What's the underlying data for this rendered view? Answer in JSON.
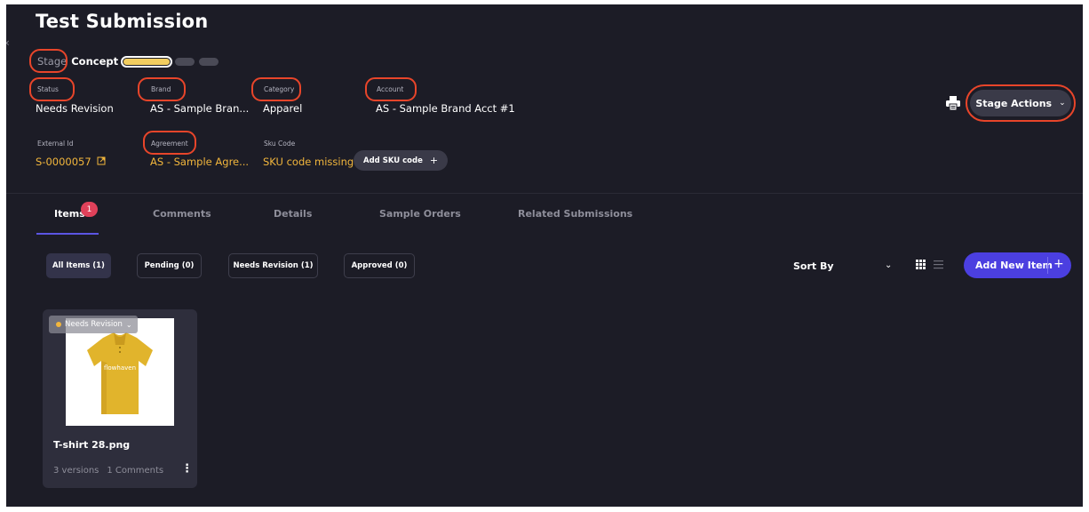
{
  "header": {
    "title": "Test Submission"
  },
  "stage": {
    "label": "Stage",
    "value": "Concept"
  },
  "fields": {
    "status": {
      "label": "Status",
      "value": "Needs Revision"
    },
    "brand": {
      "label": "Brand",
      "value": "AS - Sample Bran..."
    },
    "category": {
      "label": "Category",
      "value": "Apparel"
    },
    "account": {
      "label": "Account",
      "value": "AS - Sample Brand Acct #1"
    },
    "external_id": {
      "label": "External Id",
      "value": "S-0000057"
    },
    "agreement": {
      "label": "Agreement",
      "value": "AS - Sample Agre..."
    },
    "sku_code": {
      "label": "Sku Code",
      "value": "SKU code missing",
      "add_label": "Add SKU code"
    }
  },
  "actions": {
    "stage_actions_label": "Stage Actions"
  },
  "tabs": [
    {
      "label": "Items",
      "badge": "1"
    },
    {
      "label": "Comments"
    },
    {
      "label": "Details"
    },
    {
      "label": "Sample Orders"
    },
    {
      "label": "Related Submissions"
    }
  ],
  "filters": [
    {
      "label": "All Items (1)"
    },
    {
      "label": "Pending (0)"
    },
    {
      "label": "Needs Revision (1)"
    },
    {
      "label": "Approved (0)"
    }
  ],
  "toolbar": {
    "sort_label": "Sort By",
    "add_item_label": "Add New Item"
  },
  "items": [
    {
      "status": "Needs Revision",
      "image_text": "flowhaven",
      "filename": "T-shirt 28.png",
      "versions": "3 versions",
      "comments": "1 Comments"
    }
  ],
  "colors": {
    "background": "#1c1c26",
    "accent": "#4b3fe0",
    "link": "#f2b63c",
    "stage_active": "#f2cd5f",
    "badge": "#e0415a",
    "annotation": "#e8452a"
  }
}
